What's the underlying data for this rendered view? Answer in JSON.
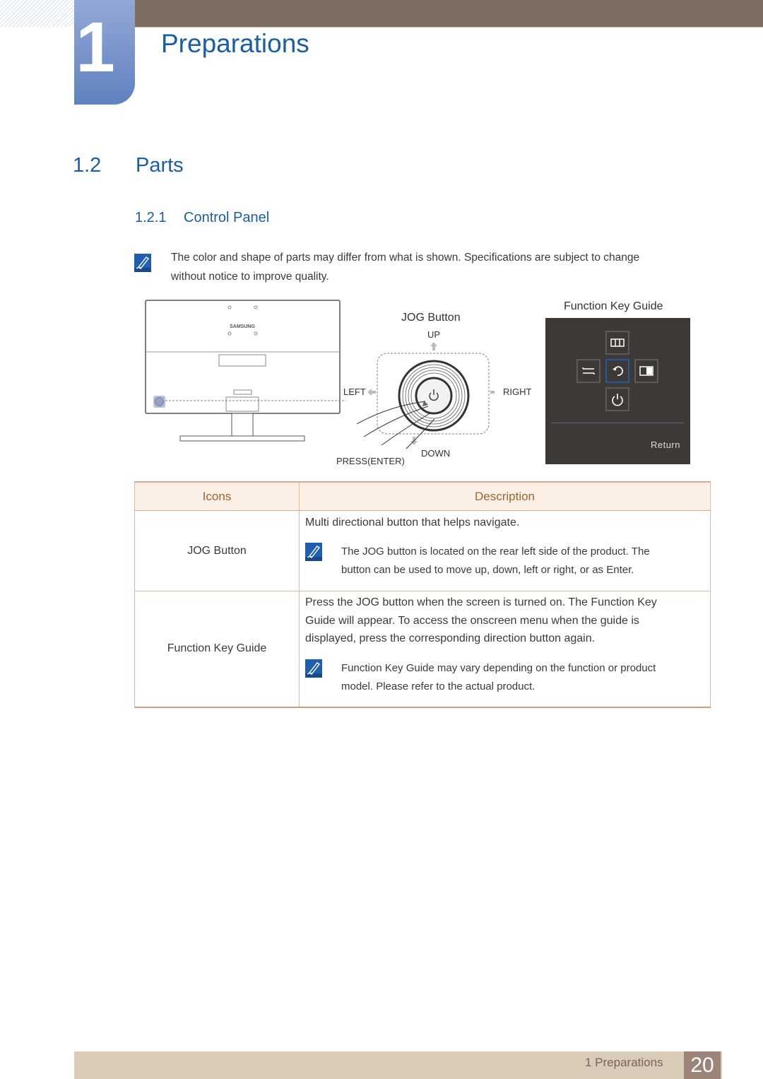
{
  "chapter": {
    "number": "1",
    "title": "Preparations"
  },
  "section": {
    "number": "1.2",
    "title": "Parts"
  },
  "subsection": {
    "number": "1.2.1",
    "title": "Control Panel"
  },
  "note_intro": {
    "icon": "note-pencil-icon",
    "line1": "The color and shape of parts may differ from what is shown. Specifications are subject to change",
    "line2": "without notice to improve quality."
  },
  "figure": {
    "monitor_brand": "SAMSUNG",
    "jog_title": "JOG Button",
    "up": "UP",
    "down": "DOWN",
    "left": "LEFT",
    "right": "RIGHT",
    "press": "PRESS(ENTER)",
    "fkg_title": "Function Key Guide",
    "fkg_return": "Return",
    "fkg_icons": [
      "menu-icon",
      "source-icon",
      "return-icon",
      "pip-icon",
      "power-icon"
    ]
  },
  "table": {
    "headers": [
      "Icons",
      "Description"
    ],
    "rows": [
      {
        "icon": "JOG Button",
        "desc": "Multi directional button that helps navigate.",
        "note_line1": "The JOG button is located on the rear left side of the product. The",
        "note_line2": "button can be used to move up, down, left or right, or as Enter."
      },
      {
        "icon": "Function Key Guide",
        "desc_line1": "Press the JOG button when the screen is turned on. The Function Key",
        "desc_line2": "Guide will appear. To access the onscreen menu when the guide is",
        "desc_line3": "displayed, press the corresponding direction button again.",
        "note_line1": "Function Key Guide may vary depending on the function or product",
        "note_line2": "model. Please refer to the actual product."
      }
    ]
  },
  "footer": {
    "chapter_label": "1 Preparations",
    "page_number": "20"
  },
  "colors": {
    "heading_blue": "#1a5ea8",
    "header_bar": "#7b6e60",
    "table_header_text": "#a0652e",
    "footer_bg": "#d8ccb9",
    "page_box": "#9d8479"
  }
}
